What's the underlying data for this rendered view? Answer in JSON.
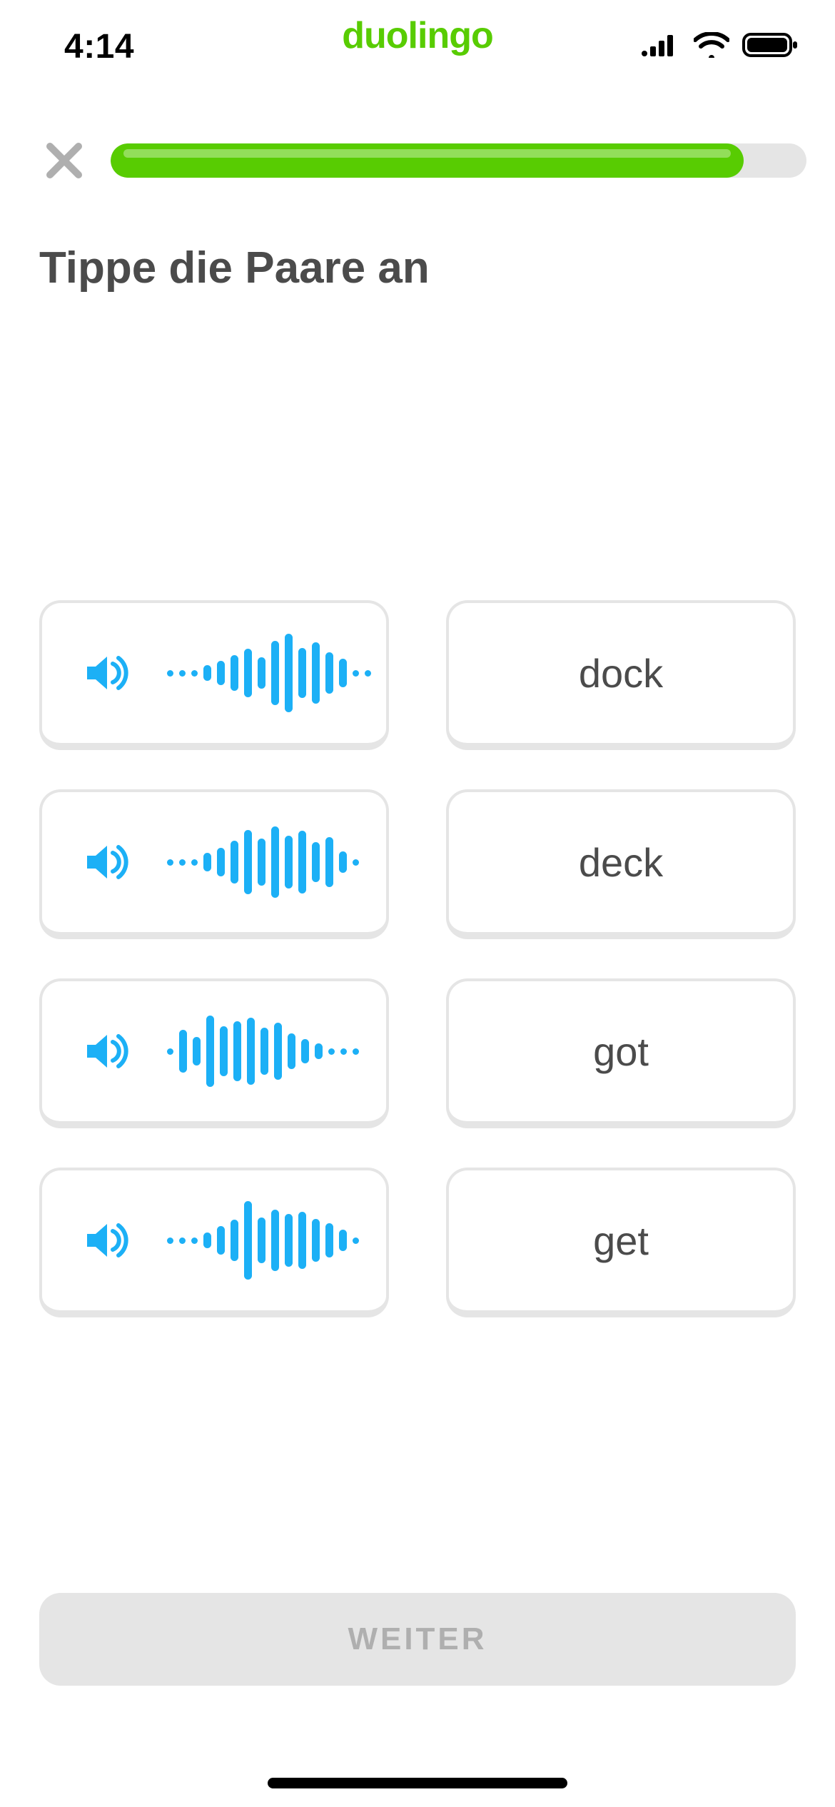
{
  "status": {
    "time": "4:14",
    "logo": "duolingo"
  },
  "header": {
    "progress_percent": 91
  },
  "prompt": "Tippe die Paare an",
  "pairs": {
    "audio_cards": [
      {
        "id": "audio-1"
      },
      {
        "id": "audio-2"
      },
      {
        "id": "audio-3"
      },
      {
        "id": "audio-4"
      }
    ],
    "word_cards": [
      {
        "label": "dock"
      },
      {
        "label": "deck"
      },
      {
        "label": "got"
      },
      {
        "label": "get"
      }
    ]
  },
  "continue_label": "WEITER",
  "colors": {
    "green": "#58cc02",
    "blue": "#1cb0f6",
    "grey_border": "#e5e5e5",
    "grey_text": "#4b4b4b",
    "grey_button_text": "#afafaf"
  }
}
